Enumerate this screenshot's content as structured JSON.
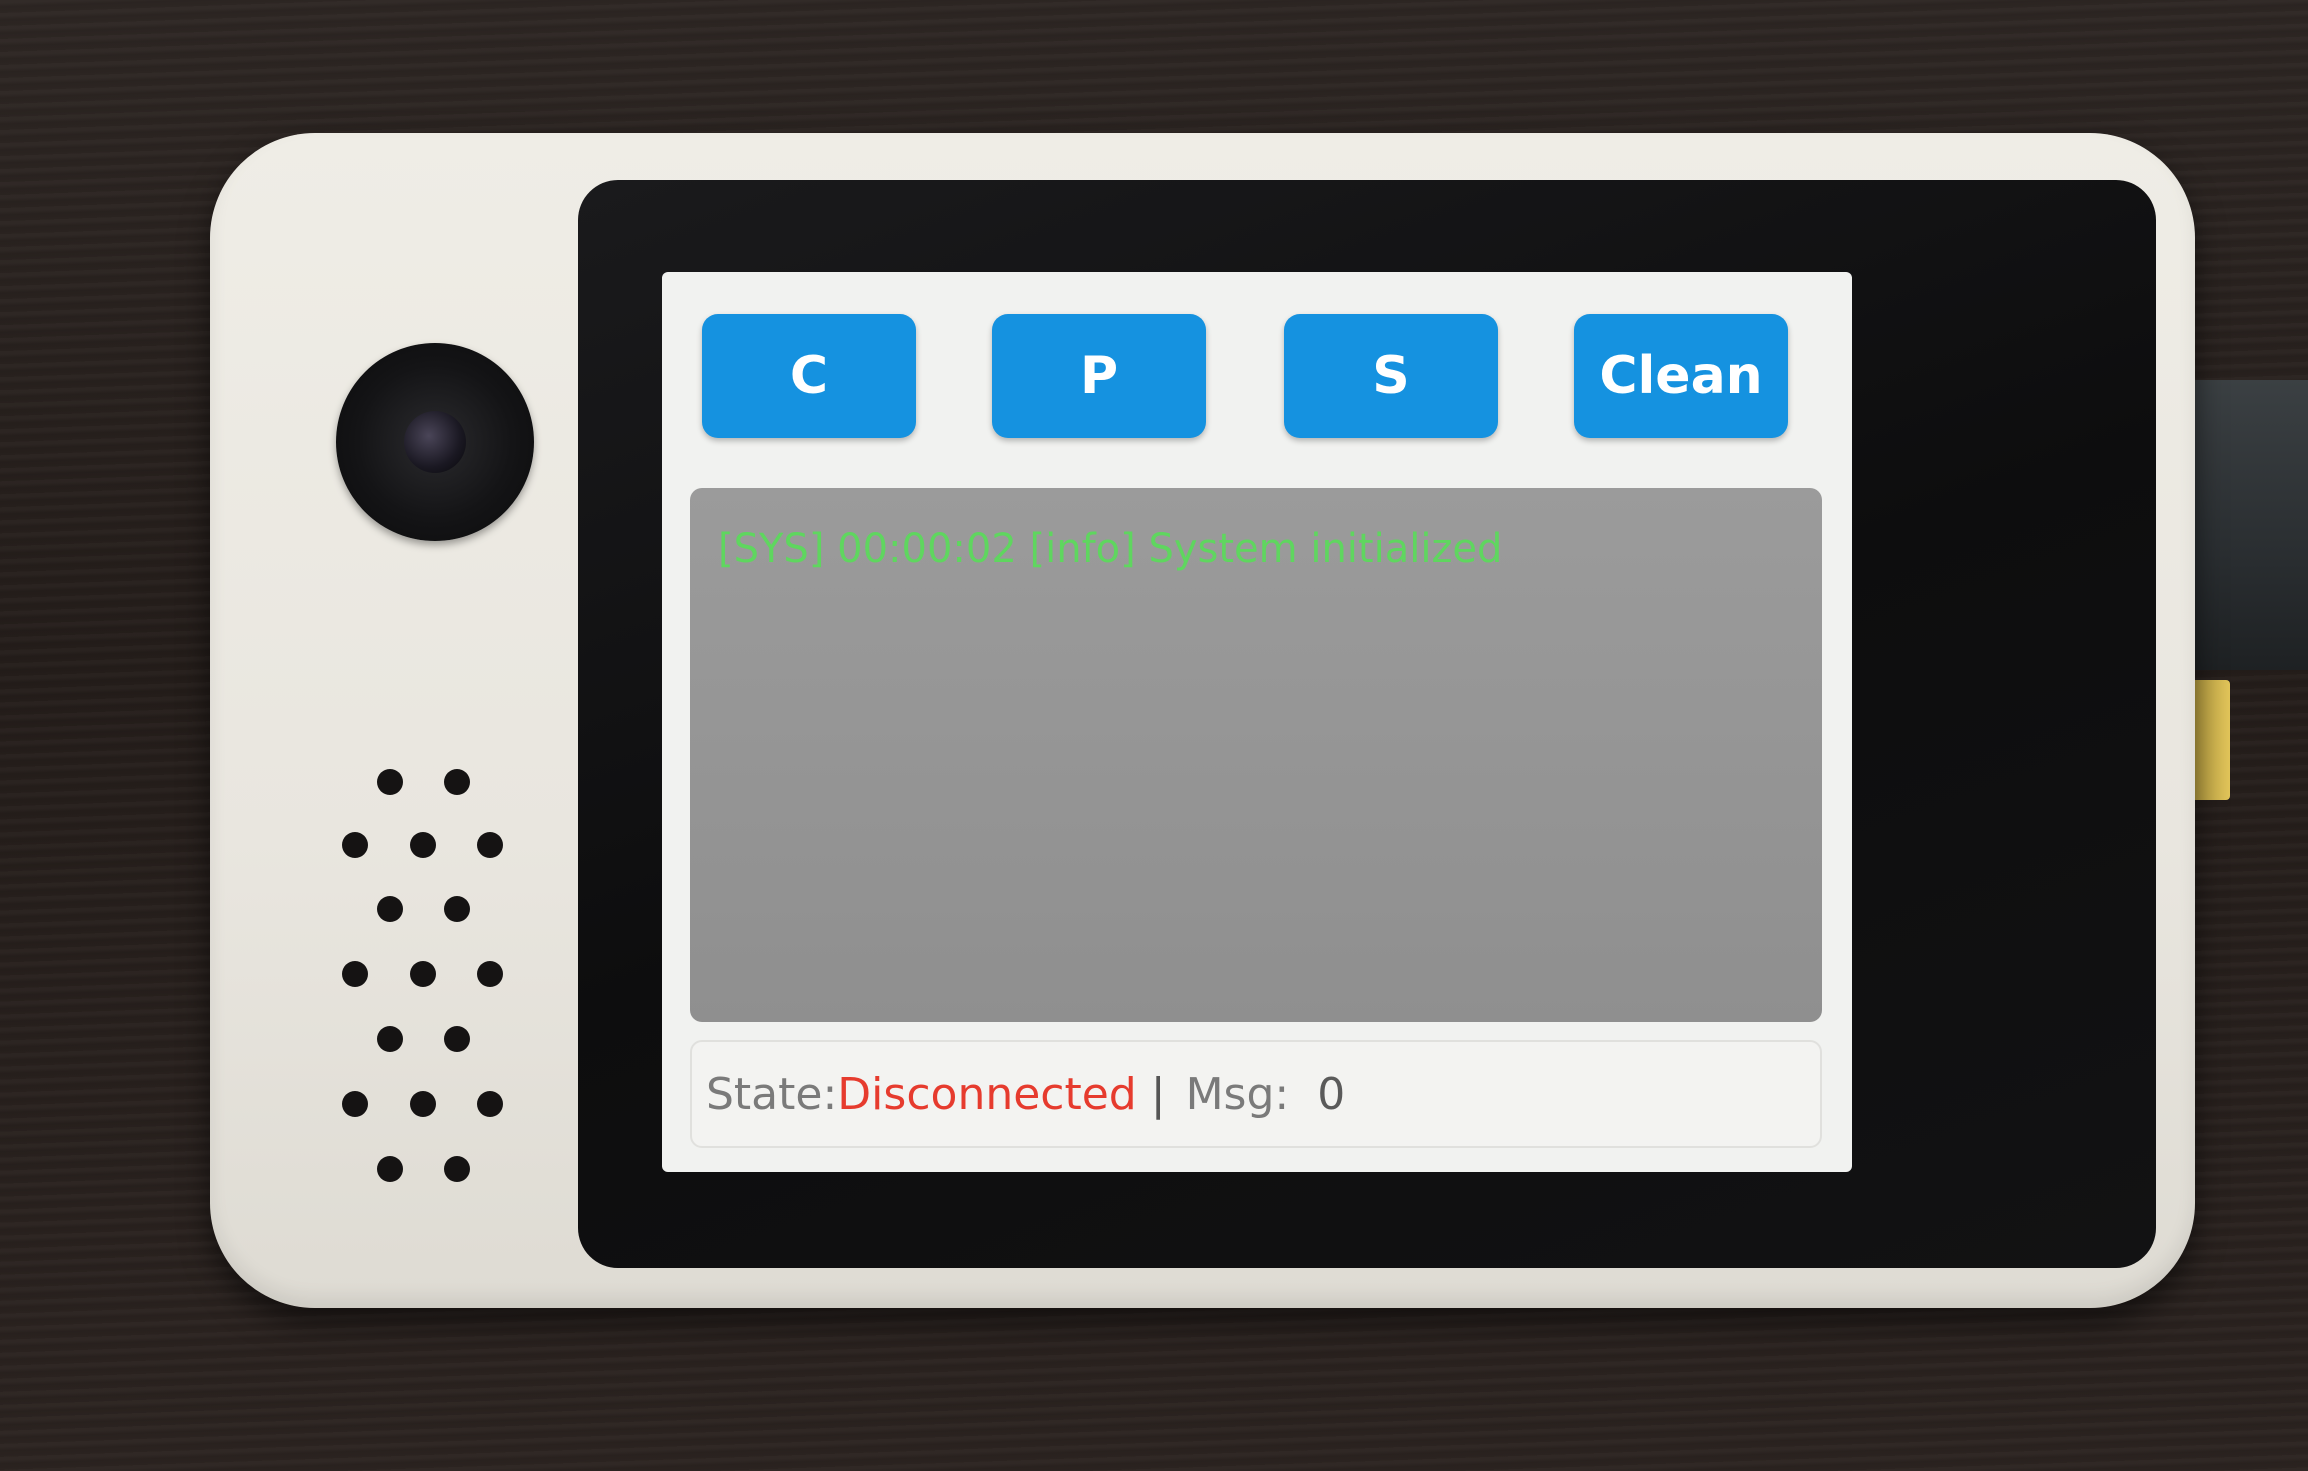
{
  "buttons": {
    "c_label": "C",
    "p_label": "P",
    "s_label": "S",
    "clean_label": "Clean"
  },
  "log": {
    "lines": [
      "[SYS] 00:00:02 [info] System initialized"
    ]
  },
  "status": {
    "state_label": "State:",
    "state_value": "Disconnected",
    "separator": "|",
    "msg_label": "Msg:",
    "msg_count": "0"
  },
  "colors": {
    "button_blue": "#1592e0",
    "log_text_green": "#5fd65f",
    "state_disconnected_red": "#e63b2e",
    "log_background_gray": "#959595"
  }
}
